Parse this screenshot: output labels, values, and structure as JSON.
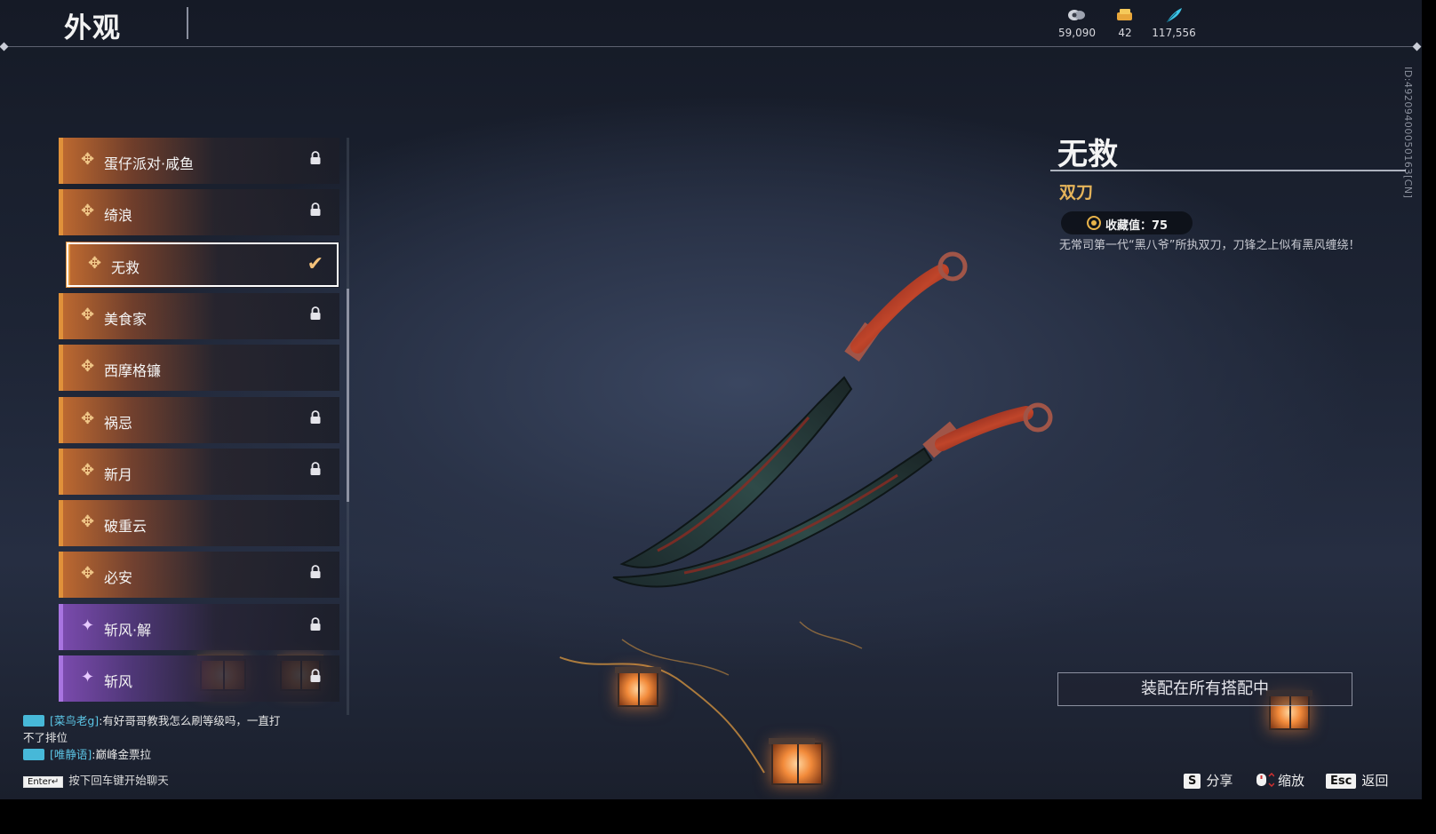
{
  "header": {
    "title": "外观",
    "currencies": [
      {
        "icon": "coin-icon",
        "value": "59,090"
      },
      {
        "icon": "ticket-icon",
        "value": "42"
      },
      {
        "icon": "feather-icon",
        "value": "117,556"
      }
    ],
    "side_id": "ID:4920940005016З[CN]"
  },
  "skins": [
    {
      "name": "蛋仔派对·咸鱼",
      "rarity": "orange",
      "locked": true
    },
    {
      "name": "绮浪",
      "rarity": "orange",
      "locked": true
    },
    {
      "name": "无救",
      "rarity": "orange",
      "locked": false,
      "selected": true
    },
    {
      "name": "美食家",
      "rarity": "orange",
      "locked": true
    },
    {
      "name": "西摩格镰",
      "rarity": "orange",
      "locked": false
    },
    {
      "name": "祸忌",
      "rarity": "orange",
      "locked": true
    },
    {
      "name": "新月",
      "rarity": "orange",
      "locked": true
    },
    {
      "name": "破重云",
      "rarity": "orange",
      "locked": false
    },
    {
      "name": "必安",
      "rarity": "orange",
      "locked": true
    },
    {
      "name": "斩风·解",
      "rarity": "purple",
      "locked": true
    },
    {
      "name": "斩风",
      "rarity": "purple",
      "locked": true
    }
  ],
  "detail": {
    "name": "无救",
    "type": "双刀",
    "collection": "收藏值：75",
    "description": "无常司第一代“黑八爷”所执双刀，刀锋之上似有黑风缠绕！",
    "equip_all": "装配在所有搭配中"
  },
  "hints": [
    {
      "key": "S",
      "label": "分享"
    },
    {
      "key": "",
      "label": "缩放"
    },
    {
      "key": "Esc",
      "label": "返回"
    }
  ],
  "chat": {
    "lines": [
      {
        "name": "[菜鸟老g]",
        "text": ":有好哥哥教我怎么刷等级吗，一直打不了排位"
      },
      {
        "name": "[唯静语]",
        "text": ":巅峰金票拉"
      }
    ],
    "enter_key": "Enter↵",
    "prompt": "按下回车键开始聊天"
  },
  "colors": {
    "orange_accent": "#e0913a",
    "purple_accent": "#a874e0",
    "gold_text": "#e6b45a"
  }
}
